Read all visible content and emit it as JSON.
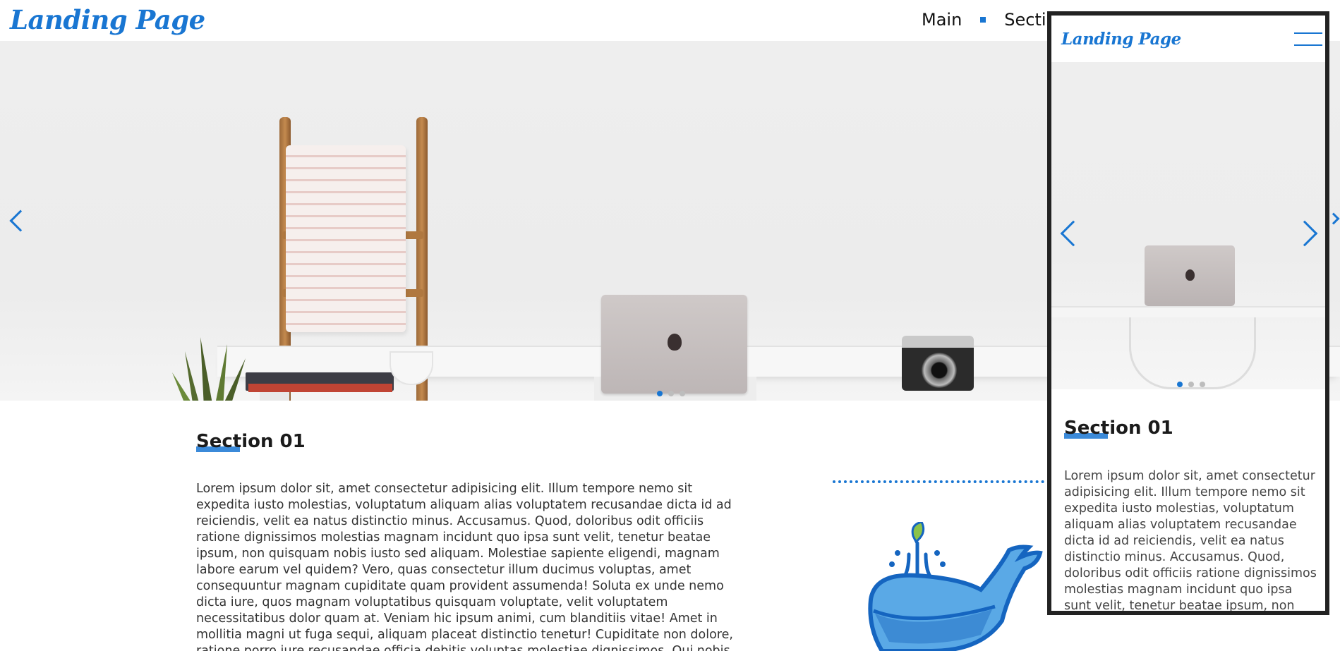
{
  "header": {
    "logo": "Landing Page",
    "nav": [
      "Main",
      "Secti"
    ]
  },
  "hero": {
    "prev_icon": "chevron-left-icon",
    "next_icon": "chevron-right-icon",
    "slides_total": 3,
    "active_slide": 1
  },
  "section": {
    "title": "Section 01",
    "body": "Lorem ipsum dolor sit, amet consectetur adipisicing elit. Illum tempore nemo sit expedita iusto molestias, voluptatum aliquam alias voluptatem recusandae dicta id ad reiciendis, velit ea natus distinctio minus. Accusamus. Quod, doloribus odit officiis ratione dignissimos molestias magnam incidunt quo ipsa sunt velit, tenetur beatae ipsum, non quisquam nobis iusto sed aliquam. Molestiae sapiente eligendi, magnam labore earum vel quidem? Vero, quas consectetur illum ducimus voluptas, amet consequuntur magnam cupiditate quam provident assumenda! Soluta ex unde nemo dicta iure, quos magnam voluptatibus quisquam voluptate, velit voluptatem necessitatibus dolor quam at. Veniam hic ipsum animi, cum blanditiis vitae! Amet in mollitia magni ut fuga sequi, aliquam placeat distinctio tenetur! Cupiditate non dolore, ratione porro iure recusandae officia debitis voluptas molestiae dignissimos. Qui nobis, minus in aliquid esse sequi saepe quidem praesentium provident accusamus deserunt, sint quasi.",
    "illustration_icon": "whale-icon"
  },
  "mobile": {
    "logo": "Landing Page",
    "menu_icon": "hamburger-menu-icon",
    "section_title": "Section 01",
    "body": "Lorem ipsum dolor sit, amet consectetur adipisicing elit. Illum tempore nemo sit expedita iusto molestias, voluptatum aliquam alias voluptatem recusandae dicta id ad reiciendis, velit ea natus distinctio minus. Accusamus. Quod, doloribus odit officiis ratione dignissimos molestias magnam incidunt quo ipsa sunt velit, tenetur beatae ipsum, non quisquam"
  },
  "colors": {
    "accent": "#1976d2",
    "frame": "#222222",
    "dot_inactive": "#bdbdbd"
  }
}
